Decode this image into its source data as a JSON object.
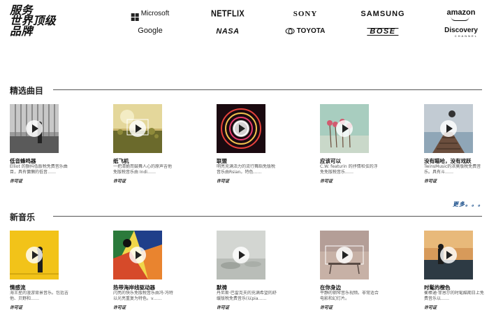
{
  "header": {
    "title_lines": [
      "服务",
      "世界顶级",
      "品牌"
    ],
    "logos": {
      "microsoft": "Microsoft",
      "netflix": "NETFLIX",
      "sony": "SONY",
      "samsung": "SAMSUNG",
      "amazon": "amazon",
      "google": "Google",
      "nasa": "NASA",
      "toyota": "TOYOTA",
      "bose": "BOSE",
      "discovery": "Discovery",
      "discovery_sub": "CHANNEL"
    }
  },
  "featured": {
    "title": "精选曲目",
    "items": [
      {
        "title": "低音蜂鸣器",
        "desc": "Elliot 的颤抖低版税免费音乐曲目，具有慵懒的低音……",
        "license": "许可证"
      },
      {
        "title": "纸飞机",
        "desc": "一把清脆而鼓舞人心的原声吉他免版税音乐由 Indi……",
        "license": "许可证"
      },
      {
        "title": "联盟",
        "desc": "明亮充满活力的流行舞蹈免版税音乐由Rsian。特色……",
        "license": "许可证"
      },
      {
        "title": "应该可以",
        "desc": "C.W. featurin 的抒情和弦的浮免免版税音乐……",
        "license": "许可证"
      },
      {
        "title": "没有瞄哈，没有戏跃",
        "desc": "TwinsMusic的浓莫版税免费音乐。具有斗……",
        "license": "许可证"
      }
    ]
  },
  "new_music": {
    "title": "新音乐",
    "more_label": "更多。。。",
    "items": [
      {
        "title": "情感流",
        "desc": "海王星的漫游背景音乐。包括吉他、贝野和……",
        "license": "许可证"
      },
      {
        "title": "热带海岸线驱动器",
        "desc": "闪亮的快乐免版税音乐由冯·冯特以光亮重复为特色。v……",
        "license": "许可证"
      },
      {
        "title": "默祷",
        "desc": "丹尼斯·巴雷克夫的充满希望的舒缓版税免费音乐(以pia……",
        "license": "许可证"
      },
      {
        "title": "在你身边",
        "desc": "平静的钢琴音乐视频。非常适合电影和幻灯片。",
        "license": "许可证"
      },
      {
        "title": "时髦的橙色",
        "desc": "衡棒通·菲恩尔的时髦酷期日上免费音乐以……",
        "license": "许可证"
      }
    ]
  }
}
